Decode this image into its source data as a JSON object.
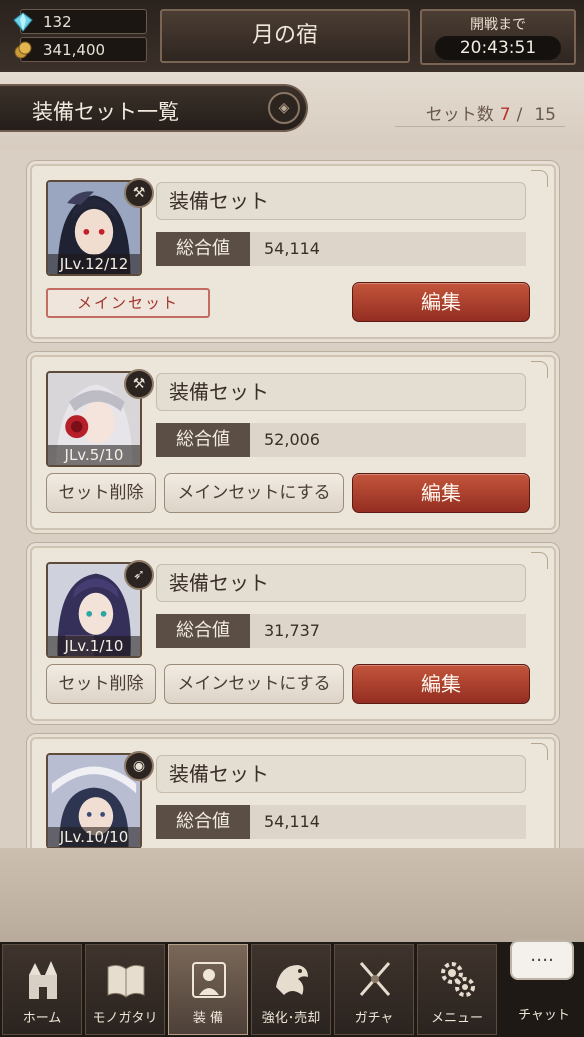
{
  "resources": {
    "gems": "132",
    "coins": "341,400"
  },
  "header": {
    "title": "月の宿",
    "timer_label": "開戦まで",
    "timer_value": "20:43:51"
  },
  "list": {
    "title": "装備セット一覧",
    "count_label": "セット数",
    "count_current": "7",
    "count_sep": "/",
    "count_max": "15"
  },
  "cards": [
    {
      "name": "装備セット",
      "stat_label": "総合値",
      "stat_value": "54,114",
      "level": "JLv.12/12",
      "weapon_icon": "wrench-icon",
      "is_main": true,
      "main_label": "メインセット",
      "edit_label": "編集"
    },
    {
      "name": "装備セット",
      "stat_label": "総合値",
      "stat_value": "52,006",
      "level": "JLv.5/10",
      "weapon_icon": "wrench-icon",
      "delete_label": "セット削除",
      "set_main_label": "メインセットにする",
      "edit_label": "編集"
    },
    {
      "name": "装備セット",
      "stat_label": "総合値",
      "stat_value": "31,737",
      "level": "JLv.1/10",
      "weapon_icon": "bow-icon",
      "delete_label": "セット削除",
      "set_main_label": "メインセットにする",
      "edit_label": "編集"
    },
    {
      "name": "装備セット",
      "stat_label": "総合値",
      "stat_value": "54,114",
      "level": "JLv.10/10",
      "weapon_icon": "orb-icon"
    }
  ],
  "tabs": [
    {
      "label": "ホーム",
      "icon": "castle-icon"
    },
    {
      "label": "モノガタリ",
      "icon": "book-icon"
    },
    {
      "label": "装 備",
      "icon": "equipment-icon",
      "active": true
    },
    {
      "label": "強化･売却",
      "icon": "dragon-icon"
    },
    {
      "label": "ガチャ",
      "icon": "crossed-swords-icon"
    },
    {
      "label": "メニュー",
      "icon": "gears-icon"
    }
  ],
  "chat": {
    "label": "チャット",
    "bubble": "…."
  }
}
